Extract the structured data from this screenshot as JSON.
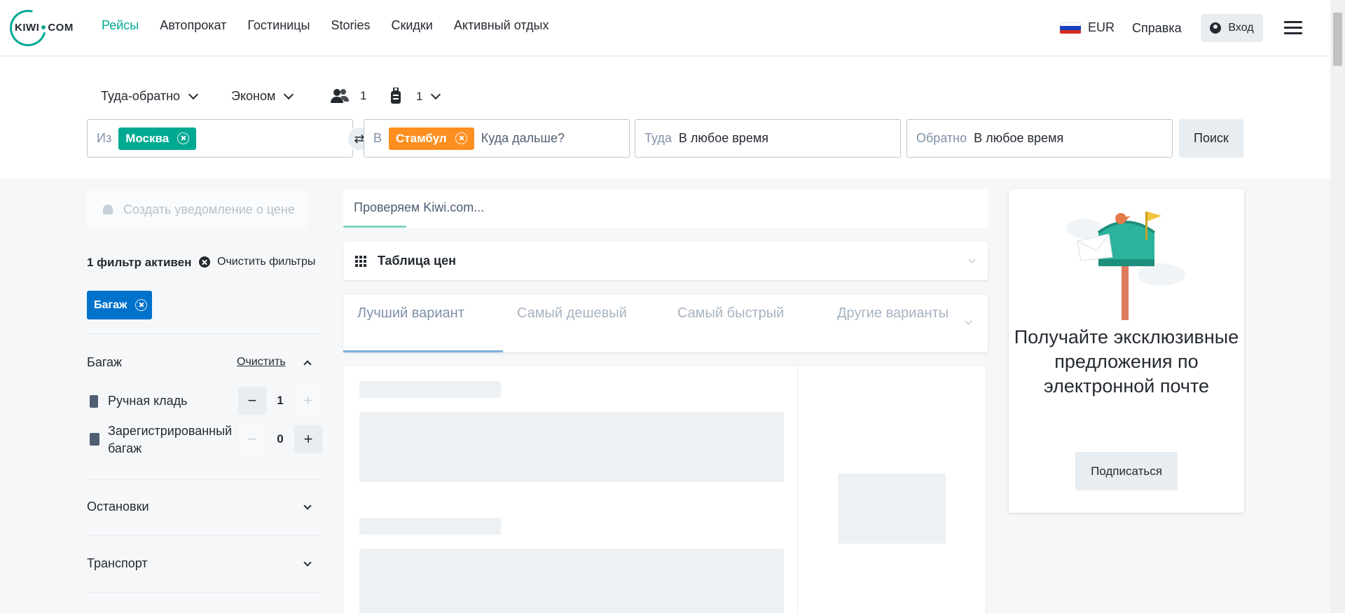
{
  "header": {
    "logo": {
      "left": "KIWI",
      "right": "COM"
    },
    "nav": [
      {
        "label": "Рейсы",
        "active": true
      },
      {
        "label": "Автопрокат",
        "active": false
      },
      {
        "label": "Гостиницы",
        "active": false
      },
      {
        "label": "Stories",
        "active": false
      },
      {
        "label": "Скидки",
        "active": false
      },
      {
        "label": "Активный отдых",
        "active": false
      }
    ],
    "currency": "EUR",
    "help": "Справка",
    "login": "Вход"
  },
  "search": {
    "trip_type": "Туда-обратно",
    "cabin_class": "Эконом",
    "passengers": "1",
    "bags": "1",
    "from_label": "Из",
    "from_chip": "Москва",
    "to_label": "В",
    "to_chip": "Стамбул",
    "to_placeholder": "Куда дальше?",
    "depart_label": "Туда",
    "depart_value": "В любое время",
    "return_label": "Обратно",
    "return_value": "В любое время",
    "search_button": "Поиск"
  },
  "filters": {
    "price_alert": "Создать уведомление о цене",
    "active_count": "1 фильтр активен",
    "clear_all": "Очистить фильтры",
    "active_tag": "Багаж",
    "bags_section": {
      "title": "Багаж",
      "clear": "Очистить",
      "rows": [
        {
          "label": "Ручная кладь",
          "value": "1"
        },
        {
          "label": "Зарегистрированный багаж",
          "value": "0"
        }
      ]
    },
    "stops_title": "Остановки",
    "transport_title": "Транспорт"
  },
  "results": {
    "checking": "Проверяем Kiwi.com...",
    "checking_progress_pct": 10,
    "price_table": "Таблица цен",
    "tabs": [
      {
        "label": "Лучший вариант",
        "active": true
      },
      {
        "label": "Самый дешевый",
        "active": false
      },
      {
        "label": "Самый быстрый",
        "active": false
      },
      {
        "label": "Другие варианты",
        "active": false
      }
    ]
  },
  "promo": {
    "headline": "Получайте эксклюзивные предложения по электронной почте",
    "button": "Подписаться"
  },
  "colors": {
    "brand": "#00a991",
    "from_chip": "#00a991",
    "to_chip": "#fc8f20",
    "filter_tag": "#0172cb"
  }
}
